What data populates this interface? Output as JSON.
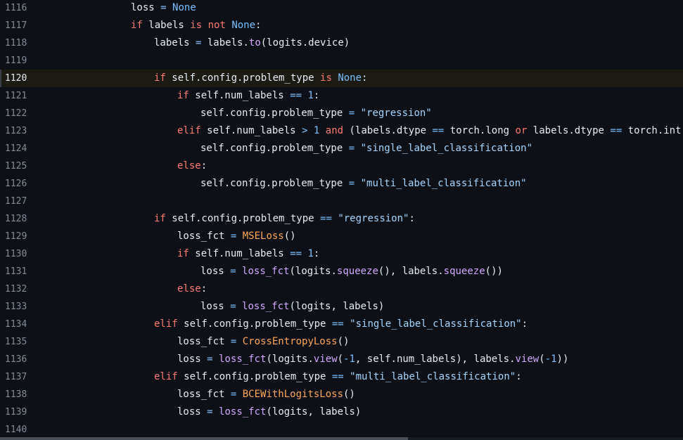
{
  "editor": {
    "current_line": "1120",
    "lines": [
      {
        "n": "1116",
        "indent": 1,
        "tokens": [
          [
            "txt",
            "loss "
          ],
          [
            "op",
            "="
          ],
          [
            "txt",
            " "
          ],
          [
            "const",
            "None"
          ]
        ]
      },
      {
        "n": "1117",
        "indent": 1,
        "tokens": [
          [
            "kw",
            "if"
          ],
          [
            "txt",
            " labels "
          ],
          [
            "kw",
            "is"
          ],
          [
            "txt",
            " "
          ],
          [
            "kw",
            "not"
          ],
          [
            "txt",
            " "
          ],
          [
            "const",
            "None"
          ],
          [
            "txt",
            ":"
          ]
        ]
      },
      {
        "n": "1118",
        "indent": 2,
        "tokens": [
          [
            "txt",
            "labels "
          ],
          [
            "op",
            "="
          ],
          [
            "txt",
            " labels."
          ],
          [
            "fn",
            "to"
          ],
          [
            "txt",
            "(logits.device)"
          ]
        ]
      },
      {
        "n": "1119",
        "indent": 0,
        "tokens": []
      },
      {
        "n": "1120",
        "indent": 2,
        "tokens": [
          [
            "kw",
            "if"
          ],
          [
            "txt",
            " self.config.problem_type "
          ],
          [
            "kw",
            "is"
          ],
          [
            "txt",
            " "
          ],
          [
            "const",
            "None"
          ],
          [
            "txt",
            ":"
          ]
        ]
      },
      {
        "n": "1121",
        "indent": 3,
        "tokens": [
          [
            "kw",
            "if"
          ],
          [
            "txt",
            " self.num_labels "
          ],
          [
            "op",
            "=="
          ],
          [
            "txt",
            " "
          ],
          [
            "num",
            "1"
          ],
          [
            "txt",
            ":"
          ]
        ]
      },
      {
        "n": "1122",
        "indent": 4,
        "tokens": [
          [
            "txt",
            "self.config.problem_type "
          ],
          [
            "op",
            "="
          ],
          [
            "txt",
            " "
          ],
          [
            "str",
            "\"regression\""
          ]
        ]
      },
      {
        "n": "1123",
        "indent": 3,
        "tokens": [
          [
            "kw",
            "elif"
          ],
          [
            "txt",
            " self.num_labels "
          ],
          [
            "op",
            ">"
          ],
          [
            "txt",
            " "
          ],
          [
            "num",
            "1"
          ],
          [
            "txt",
            " "
          ],
          [
            "kw",
            "and"
          ],
          [
            "txt",
            " (labels.dtype "
          ],
          [
            "op",
            "=="
          ],
          [
            "txt",
            " torch.long "
          ],
          [
            "kw",
            "or"
          ],
          [
            "txt",
            " labels.dtype "
          ],
          [
            "op",
            "=="
          ],
          [
            "txt",
            " torch.int):"
          ]
        ]
      },
      {
        "n": "1124",
        "indent": 4,
        "tokens": [
          [
            "txt",
            "self.config.problem_type "
          ],
          [
            "op",
            "="
          ],
          [
            "txt",
            " "
          ],
          [
            "str",
            "\"single_label_classification\""
          ]
        ]
      },
      {
        "n": "1125",
        "indent": 3,
        "tokens": [
          [
            "kw",
            "else"
          ],
          [
            "txt",
            ":"
          ]
        ]
      },
      {
        "n": "1126",
        "indent": 4,
        "tokens": [
          [
            "txt",
            "self.config.problem_type "
          ],
          [
            "op",
            "="
          ],
          [
            "txt",
            " "
          ],
          [
            "str",
            "\"multi_label_classification\""
          ]
        ]
      },
      {
        "n": "1127",
        "indent": 0,
        "tokens": []
      },
      {
        "n": "1128",
        "indent": 2,
        "tokens": [
          [
            "kw",
            "if"
          ],
          [
            "txt",
            " self.config.problem_type "
          ],
          [
            "op",
            "=="
          ],
          [
            "txt",
            " "
          ],
          [
            "str",
            "\"regression\""
          ],
          [
            "txt",
            ":"
          ]
        ]
      },
      {
        "n": "1129",
        "indent": 3,
        "tokens": [
          [
            "txt",
            "loss_fct "
          ],
          [
            "op",
            "="
          ],
          [
            "txt",
            " "
          ],
          [
            "cls",
            "MSELoss"
          ],
          [
            "txt",
            "()"
          ]
        ]
      },
      {
        "n": "1130",
        "indent": 3,
        "tokens": [
          [
            "kw",
            "if"
          ],
          [
            "txt",
            " self.num_labels "
          ],
          [
            "op",
            "=="
          ],
          [
            "txt",
            " "
          ],
          [
            "num",
            "1"
          ],
          [
            "txt",
            ":"
          ]
        ]
      },
      {
        "n": "1131",
        "indent": 4,
        "tokens": [
          [
            "txt",
            "loss "
          ],
          [
            "op",
            "="
          ],
          [
            "txt",
            " "
          ],
          [
            "fn",
            "loss_fct"
          ],
          [
            "txt",
            "(logits."
          ],
          [
            "fn",
            "squeeze"
          ],
          [
            "txt",
            "(), labels."
          ],
          [
            "fn",
            "squeeze"
          ],
          [
            "txt",
            "())"
          ]
        ]
      },
      {
        "n": "1132",
        "indent": 3,
        "tokens": [
          [
            "kw",
            "else"
          ],
          [
            "txt",
            ":"
          ]
        ]
      },
      {
        "n": "1133",
        "indent": 4,
        "tokens": [
          [
            "txt",
            "loss "
          ],
          [
            "op",
            "="
          ],
          [
            "txt",
            " "
          ],
          [
            "fn",
            "loss_fct"
          ],
          [
            "txt",
            "(logits, labels)"
          ]
        ]
      },
      {
        "n": "1134",
        "indent": 2,
        "tokens": [
          [
            "kw",
            "elif"
          ],
          [
            "txt",
            " self.config.problem_type "
          ],
          [
            "op",
            "=="
          ],
          [
            "txt",
            " "
          ],
          [
            "str",
            "\"single_label_classification\""
          ],
          [
            "txt",
            ":"
          ]
        ]
      },
      {
        "n": "1135",
        "indent": 3,
        "tokens": [
          [
            "txt",
            "loss_fct "
          ],
          [
            "op",
            "="
          ],
          [
            "txt",
            " "
          ],
          [
            "cls",
            "CrossEntropyLoss"
          ],
          [
            "txt",
            "()"
          ]
        ]
      },
      {
        "n": "1136",
        "indent": 3,
        "tokens": [
          [
            "txt",
            "loss "
          ],
          [
            "op",
            "="
          ],
          [
            "txt",
            " "
          ],
          [
            "fn",
            "loss_fct"
          ],
          [
            "txt",
            "(logits."
          ],
          [
            "fn",
            "view"
          ],
          [
            "txt",
            "("
          ],
          [
            "op",
            "-"
          ],
          [
            "num",
            "1"
          ],
          [
            "txt",
            ", self.num_labels), labels."
          ],
          [
            "fn",
            "view"
          ],
          [
            "txt",
            "("
          ],
          [
            "op",
            "-"
          ],
          [
            "num",
            "1"
          ],
          [
            "txt",
            "))"
          ]
        ]
      },
      {
        "n": "1137",
        "indent": 2,
        "tokens": [
          [
            "kw",
            "elif"
          ],
          [
            "txt",
            " self.config.problem_type "
          ],
          [
            "op",
            "=="
          ],
          [
            "txt",
            " "
          ],
          [
            "str",
            "\"multi_label_classification\""
          ],
          [
            "txt",
            ":"
          ]
        ]
      },
      {
        "n": "1138",
        "indent": 3,
        "tokens": [
          [
            "txt",
            "loss_fct "
          ],
          [
            "op",
            "="
          ],
          [
            "txt",
            " "
          ],
          [
            "cls",
            "BCEWithLogitsLoss"
          ],
          [
            "txt",
            "()"
          ]
        ]
      },
      {
        "n": "1139",
        "indent": 3,
        "tokens": [
          [
            "txt",
            "loss "
          ],
          [
            "op",
            "="
          ],
          [
            "txt",
            " "
          ],
          [
            "fn",
            "loss_fct"
          ],
          [
            "txt",
            "(logits, labels)"
          ]
        ]
      },
      {
        "n": "1140",
        "indent": 0,
        "tokens": []
      }
    ]
  },
  "theme": {
    "background": "#0d1117",
    "current_line_bg": "#1b1b14",
    "keyword": "#ff7b72",
    "constant": "#79c0ff",
    "string": "#a5d6ff",
    "function": "#d2a8ff",
    "class": "#ffa657",
    "text": "#e6edf3",
    "line_number": "#848d97"
  }
}
